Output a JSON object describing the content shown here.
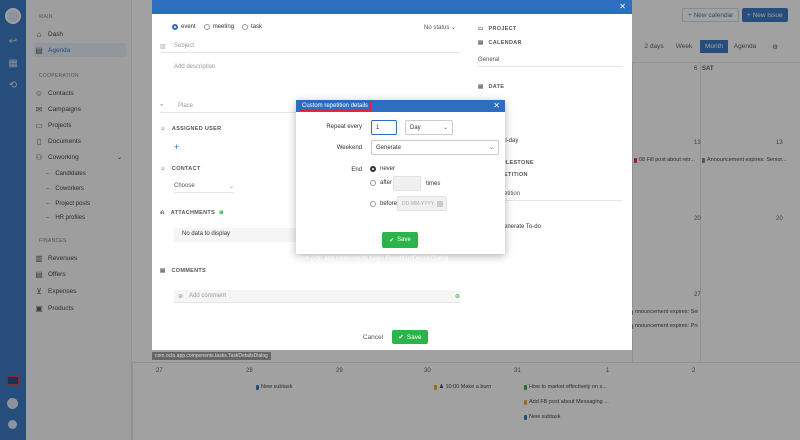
{
  "sidebar": {
    "main_label": "MAIN",
    "items_main": [
      {
        "label": "Dash",
        "icon": "dashboard-icon"
      },
      {
        "label": "Agenda",
        "icon": "calendar-icon"
      }
    ],
    "cooperation_label": "COOPERATION",
    "items_coop": [
      {
        "label": "Contacts",
        "icon": "contacts-icon"
      },
      {
        "label": "Campaigns",
        "icon": "megaphone-icon"
      },
      {
        "label": "Projects",
        "icon": "folder-icon"
      },
      {
        "label": "Documents",
        "icon": "document-icon"
      },
      {
        "label": "Coworking",
        "icon": "coworking-icon"
      }
    ],
    "coworking_sub": [
      "Candidates",
      "Coworkers",
      "Project posts",
      "HR profiles"
    ],
    "finances_label": "FINANCES",
    "items_fin": [
      {
        "label": "Revenues",
        "icon": "revenue-icon"
      },
      {
        "label": "Offers",
        "icon": "offers-icon"
      },
      {
        "label": "Expenses",
        "icon": "cart-icon"
      },
      {
        "label": "Products",
        "icon": "box-icon"
      }
    ]
  },
  "calendar": {
    "new_calendar": "+ New calendar",
    "new_issue": "+ New issue",
    "views": [
      "2 days",
      "Week",
      "Month",
      "Agenda"
    ],
    "active_view": "Month",
    "sat_label": "SAT",
    "days": {
      "d1": "6",
      "d2": "13",
      "d3": "20",
      "d4": "27",
      "d5": "28",
      "d6": "29",
      "d7": "30",
      "d8": "31",
      "d9": "1",
      "d10": "2",
      "d11": "27"
    },
    "events": {
      "e1": "08 Fill post about retr...",
      "e2": "Announcement expires: Senior...",
      "e3": "nnouncement expires: Senior...",
      "e4": "nnouncement expires: Project ...",
      "e5": "New subtask",
      "e6": "♟ 10:00 Make a burn",
      "e7": "How to market effectively on s...",
      "e8": "Add FB post about Messaging ...",
      "e9": "New subtask"
    }
  },
  "task_modal": {
    "types": [
      "event",
      "meeting",
      "task"
    ],
    "status": "No status",
    "subject_placeholder": "Subject",
    "description_placeholder": "Add description",
    "place_placeholder": "Place",
    "assigned_user": "ASSIGNED USER",
    "contact": "CONTACT",
    "choose": "Choose",
    "attachments": "ATTACHMENTS",
    "no_data": "No data to display",
    "comments": "COMMENTS",
    "add_comment": "Add comment",
    "cancel": "Cancel",
    "save": "Save",
    "right": {
      "project": "PROJECT",
      "calendar": "CALENDAR",
      "calendar_value": "General",
      "date": "DATE",
      "allday": "ll-day",
      "milestone": "ILESTONE",
      "repetition": "ETITION",
      "repetition_value": "etition",
      "generate": "enerate To-do"
    }
  },
  "repetition_dialog": {
    "title": "Custom repetition details",
    "repeat_every_label": "Repeat every",
    "repeat_every_value": "1",
    "unit": "Day",
    "weekend_label": "Weekend",
    "weekend_value": "Generate",
    "end_label": "End",
    "never": "never",
    "after": "after",
    "times": "times",
    "before": "before",
    "date_placeholder": "DD-MM-YYYY",
    "save": "Save",
    "class_name": "com.octo.app.components.tasks.RepetitionDetailsDialog"
  },
  "tooltip": "com.octo.app.components.tasks.TaskDetailsDialog"
}
